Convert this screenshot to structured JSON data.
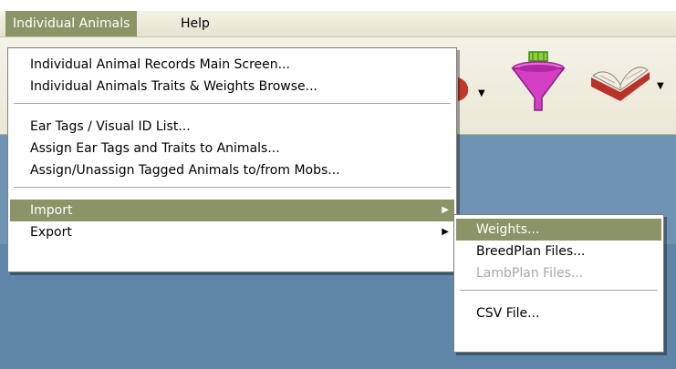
{
  "menubar": {
    "items": [
      {
        "label": "Individual Animals"
      },
      {
        "label": "Help"
      }
    ]
  },
  "main_menu": {
    "items": [
      {
        "label": "Individual Animal Records Main Screen..."
      },
      {
        "label": "Individual Animals Traits & Weights Browse..."
      },
      {
        "label": "Ear Tags / Visual ID List..."
      },
      {
        "label": "Assign Ear Tags and Traits to Animals..."
      },
      {
        "label": "Assign/Unassign Tagged Animals to/from Mobs..."
      },
      {
        "label": "Import"
      },
      {
        "label": "Export"
      }
    ]
  },
  "import_submenu": {
    "items": [
      {
        "label": "Weights..."
      },
      {
        "label": "BreedPlan Files..."
      },
      {
        "label": "LambPlan Files..."
      },
      {
        "label": "CSV File..."
      }
    ]
  },
  "toolbar": {
    "icons": [
      "dropdown-button-icon",
      "filter-funnel-icon",
      "open-book-icon"
    ]
  },
  "colors": {
    "highlight": "#8b9466",
    "desktop": "#5f86a8",
    "menubar": "#ece9d8"
  }
}
